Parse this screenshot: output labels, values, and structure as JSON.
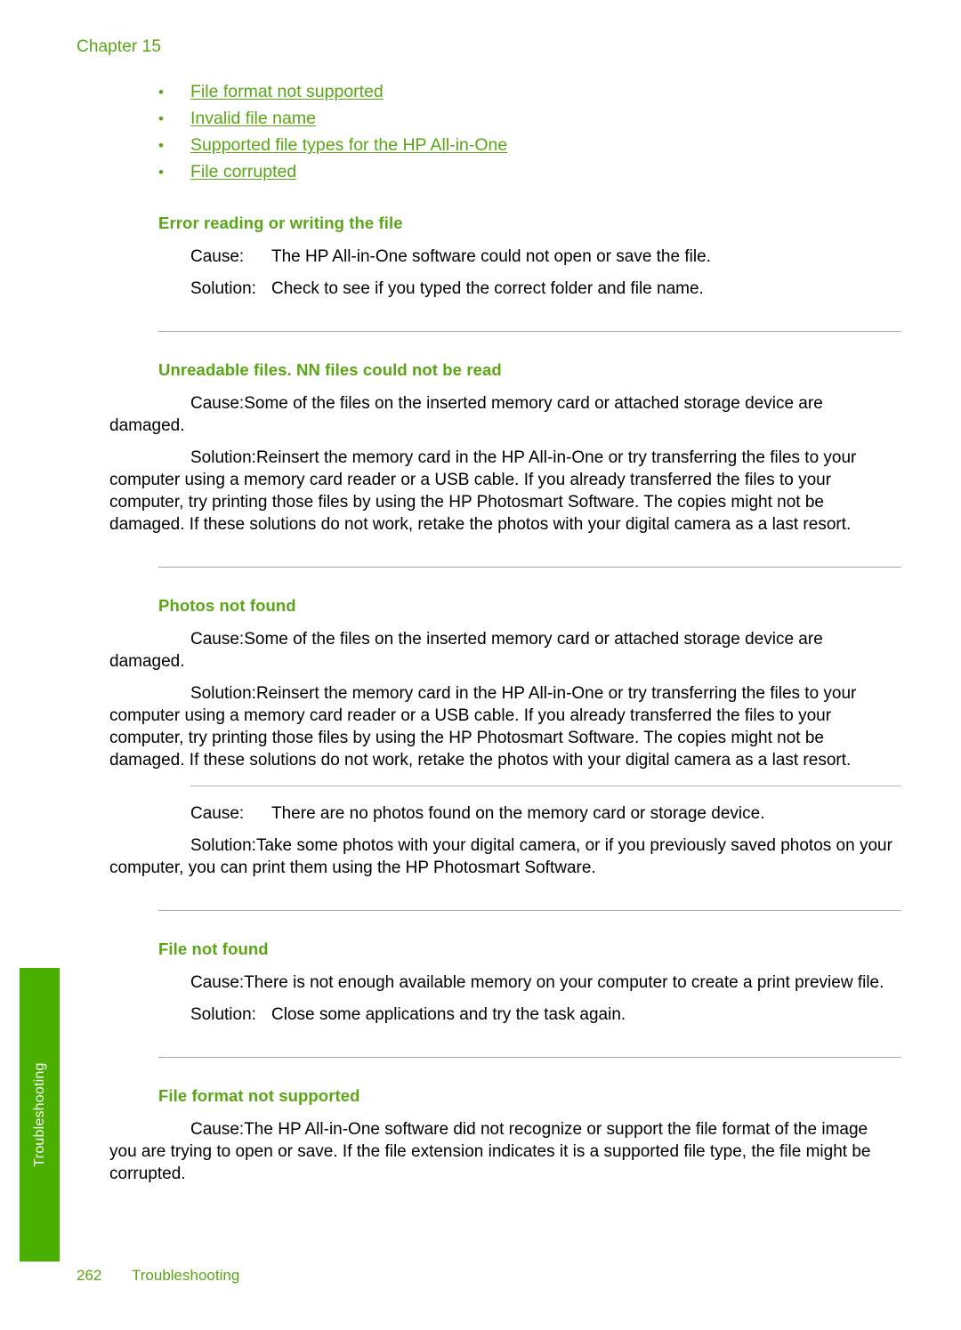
{
  "page": {
    "chapter_label": "Chapter 15",
    "side_tab_label": "Troubleshooting",
    "footer_page_number": "262",
    "footer_section_title": "Troubleshooting",
    "accent_green": "#5aa516",
    "tab_green": "#4aaf00",
    "rule_color": "#a8a8a8",
    "body_color": "#000000"
  },
  "toc": {
    "bullet_glyph": "•",
    "items": [
      {
        "label": "File format not supported"
      },
      {
        "label": "Invalid file name"
      },
      {
        "label": "Supported file types for the HP All-in-One"
      },
      {
        "label": "File corrupted"
      }
    ]
  },
  "labels": {
    "cause": "Cause:",
    "solution": "Solution:"
  },
  "sections": [
    {
      "heading": "Error reading or writing the file",
      "entries": [
        {
          "cause": "The HP All-in-One software could not open or save the file.",
          "solution": "Check to see if you typed the correct folder and file name."
        }
      ]
    },
    {
      "heading": "Unreadable files. NN files could not be read",
      "entries": [
        {
          "cause": "Some of the files on the inserted memory card or attached storage device are damaged.",
          "solution": "Reinsert the memory card in the HP All-in-One or try transferring the files to your computer using a memory card reader or a USB cable. If you already transferred the files to your computer, try printing those files by using the HP Photosmart Software. The copies might not be damaged. If these solutions do not work, retake the photos with your digital camera as a last resort."
        }
      ]
    },
    {
      "heading": "Photos not found",
      "entries": [
        {
          "cause": "Some of the files on the inserted memory card or attached storage device are damaged.",
          "solution": "Reinsert the memory card in the HP All-in-One or try transferring the files to your computer using a memory card reader or a USB cable. If you already transferred the files to your computer, try printing those files by using the HP Photosmart Software. The copies might not be damaged. If these solutions do not work, retake the photos with your digital camera as a last resort."
        },
        {
          "cause": "There are no photos found on the memory card or storage device.",
          "solution": "Take some photos with your digital camera, or if you previously saved photos on your computer, you can print them using the HP Photosmart Software."
        }
      ]
    },
    {
      "heading": "File not found",
      "entries": [
        {
          "cause": "There is not enough available memory on your computer to create a print preview file.",
          "solution": "Close some applications and try the task again."
        }
      ]
    },
    {
      "heading": "File format not supported",
      "entries": [
        {
          "cause": "The HP All-in-One software did not recognize or support the file format of the image you are trying to open or save. If the file extension indicates it is a supported file type, the file might be corrupted.",
          "solution": null
        }
      ]
    }
  ]
}
